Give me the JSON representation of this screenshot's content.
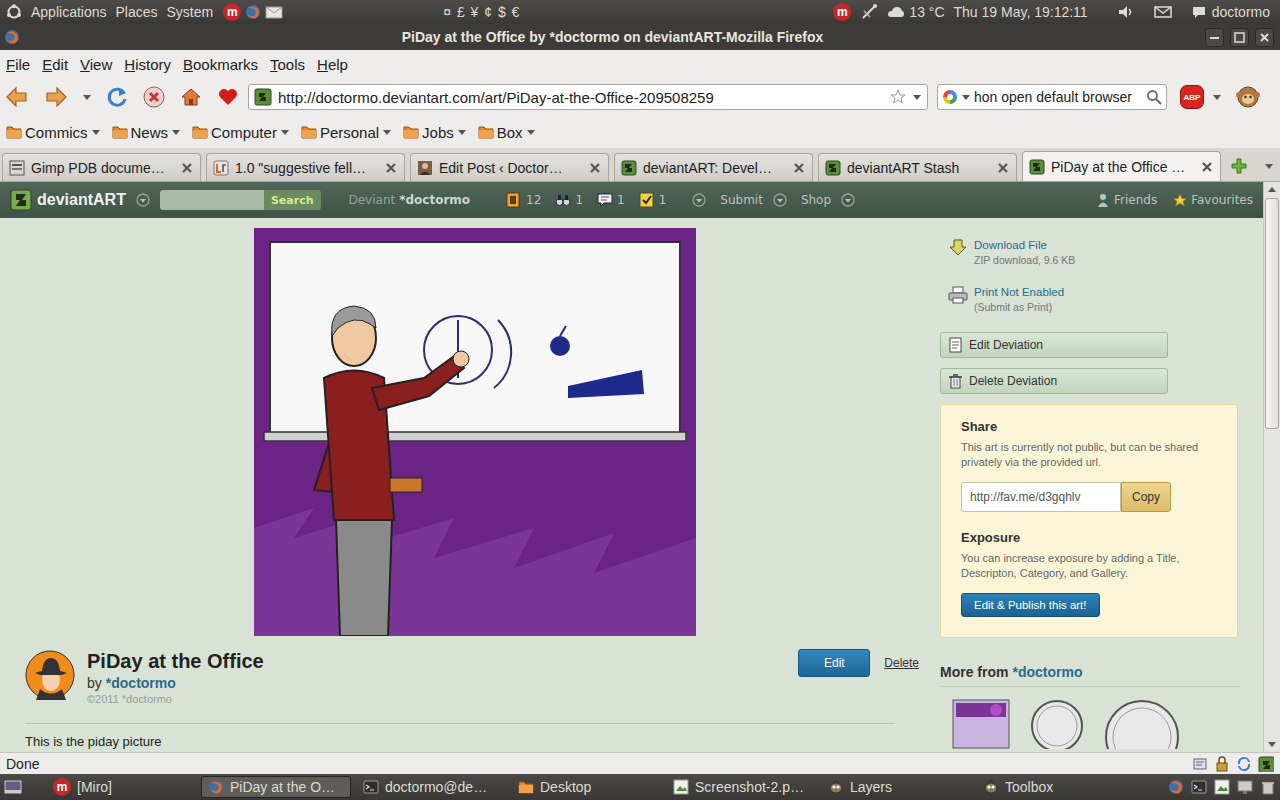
{
  "top_panel": {
    "menus": [
      "Applications",
      "Places",
      "System"
    ],
    "miro_icon": "m",
    "currencies": "¤ £ ¥ ¢ $ €",
    "temperature": "13 °C",
    "clock": "Thu 19 May, 19:12:11",
    "user": "doctormo"
  },
  "window": {
    "title": "PiDay at the Office by *doctormo on deviantART-Mozilla Firefox"
  },
  "menubar": [
    "File",
    "Edit",
    "View",
    "History",
    "Bookmarks",
    "Tools",
    "Help"
  ],
  "navbar": {
    "url": "http://doctormo.deviantart.com/art/PiDay-at-the-Office-209508259",
    "search": "hon open default browser",
    "abp": "ABP"
  },
  "bookmarks": [
    "Commics",
    "News",
    "Computer",
    "Personal",
    "Jobs",
    "Box"
  ],
  "tabs": [
    {
      "label": "Gimp PDB docume…",
      "kind": "gimp",
      "selected": false
    },
    {
      "label": "1.0 \"suggestive fell…",
      "kind": "launchpad",
      "selected": false
    },
    {
      "label": "Edit Post ‹ Doctor…",
      "kind": "blog",
      "selected": false
    },
    {
      "label": "deviantART: Devel…",
      "kind": "deviantart",
      "selected": false
    },
    {
      "label": "deviantART Stash",
      "kind": "deviantart",
      "selected": false
    },
    {
      "label": "PiDay at the Office …",
      "kind": "deviantart",
      "selected": true
    }
  ],
  "da_header": {
    "logo": "deviantART",
    "search_button": "Search",
    "deviant_label": "Deviant",
    "deviant_name": "*doctormo",
    "counters": [
      {
        "count": "12",
        "kind": "messages"
      },
      {
        "count": "1",
        "kind": "watch"
      },
      {
        "count": "1",
        "kind": "comments"
      },
      {
        "count": "1",
        "kind": "notes"
      }
    ],
    "menus": [
      "Submit",
      "Shop"
    ],
    "links": [
      {
        "label": "Friends",
        "kind": "friends"
      },
      {
        "label": "Favourites",
        "kind": "favourites"
      }
    ]
  },
  "deviation": {
    "title": "PiDay at the Office",
    "by": "by",
    "artist": "*doctormo",
    "copyright": "©2011 *doctormo",
    "edit": "Edit",
    "delete": "Delete",
    "description": "This is the piday picture"
  },
  "sidebar": {
    "actions": [
      {
        "label": "Download File",
        "detail": "ZIP download, 9.6 KB",
        "kind": "download"
      },
      {
        "label": "Print Not Enabled",
        "detail": "(Submit as Print)",
        "kind": "print"
      }
    ],
    "buttons": [
      {
        "label": "Edit Deviation",
        "kind": "edit"
      },
      {
        "label": "Delete Deviation",
        "kind": "delete"
      }
    ],
    "share": {
      "title": "Share",
      "text": "This art is currently not public, but can be shared privately via the provided url.",
      "url": "http://fav.me/d3gqhlv",
      "copy": "Copy"
    },
    "exposure": {
      "title": "Exposure",
      "text": "You can increase exposure by adding a Title, Descripton, Category, and Gallery.",
      "button": "Edit & Publish this art!"
    },
    "more_from": {
      "label": "More from",
      "artist": "*doctormo"
    }
  },
  "scrollbar": {
    "level": 0.43
  },
  "status_bar": {
    "text": "Done"
  },
  "taskbar": [
    {
      "label": "[Miro]",
      "kind": "miro",
      "selected": false
    },
    {
      "label": "PiDay at the O…",
      "kind": "firefox",
      "selected": true
    },
    {
      "label": "doctormo@de…",
      "kind": "terminal",
      "selected": false
    },
    {
      "label": "Desktop",
      "kind": "folder",
      "selected": false
    },
    {
      "label": "Screenshot-2.p…",
      "kind": "image",
      "selected": false
    },
    {
      "label": "Layers",
      "kind": "gimp",
      "selected": false
    },
    {
      "label": "Toolbox",
      "kind": "gimp",
      "selected": false
    }
  ]
}
